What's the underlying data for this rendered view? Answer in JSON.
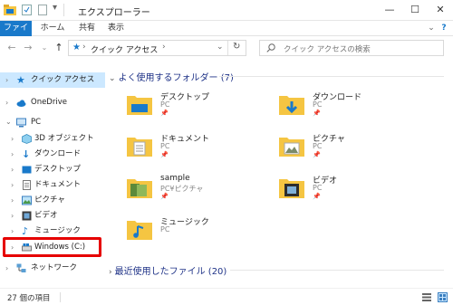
{
  "window": {
    "title": "エクスプローラー",
    "minimize": "—",
    "maximize": "☐",
    "close": "✕"
  },
  "ribbon": {
    "tabs": [
      "ファイル",
      "ホーム",
      "共有",
      "表示"
    ],
    "expand": "⌄",
    "help": "?"
  },
  "address": {
    "path": "クイック アクセス",
    "search_placeholder": "クイック アクセスの検索"
  },
  "sidebar": {
    "items": [
      {
        "label": "クイック アクセス",
        "icon": "star-icon",
        "selected": true
      },
      {
        "label": "OneDrive",
        "icon": "cloud-icon"
      },
      {
        "label": "PC",
        "icon": "pc-icon"
      },
      {
        "label": "3D オブジェクト",
        "icon": "cube-icon"
      },
      {
        "label": "ダウンロード",
        "icon": "download-icon"
      },
      {
        "label": "デスクトップ",
        "icon": "desktop-icon"
      },
      {
        "label": "ドキュメント",
        "icon": "document-icon"
      },
      {
        "label": "ピクチャ",
        "icon": "picture-icon"
      },
      {
        "label": "ビデオ",
        "icon": "video-icon"
      },
      {
        "label": "ミュージック",
        "icon": "music-icon"
      },
      {
        "label": "Windows (C:)",
        "icon": "drive-icon",
        "highlighted": true
      },
      {
        "label": "ネットワーク",
        "icon": "network-icon"
      }
    ]
  },
  "main": {
    "frequent_header": "よく使用するフォルダー (7)",
    "recent_header": "最近使用したファイル (20)",
    "folders": [
      {
        "name": "デスクトップ",
        "sub": "PC",
        "icon": "desktop-folder-icon"
      },
      {
        "name": "ダウンロード",
        "sub": "PC",
        "icon": "download-folder-icon"
      },
      {
        "name": "ドキュメント",
        "sub": "PC",
        "icon": "documents-folder-icon"
      },
      {
        "name": "ピクチャ",
        "sub": "PC",
        "icon": "pictures-folder-icon"
      },
      {
        "name": "sample",
        "sub": "PC¥ピクチャ",
        "icon": "sample-folder-icon"
      },
      {
        "name": "ビデオ",
        "sub": "PC",
        "icon": "videos-folder-icon"
      },
      {
        "name": "ミュージック",
        "sub": "PC",
        "icon": "music-folder-icon"
      }
    ]
  },
  "status": {
    "count": "27 個の項目"
  },
  "colors": {
    "accent": "#1979ca",
    "selection": "#cce8ff",
    "highlight_box": "#e60000",
    "folder": "#f5c542"
  }
}
